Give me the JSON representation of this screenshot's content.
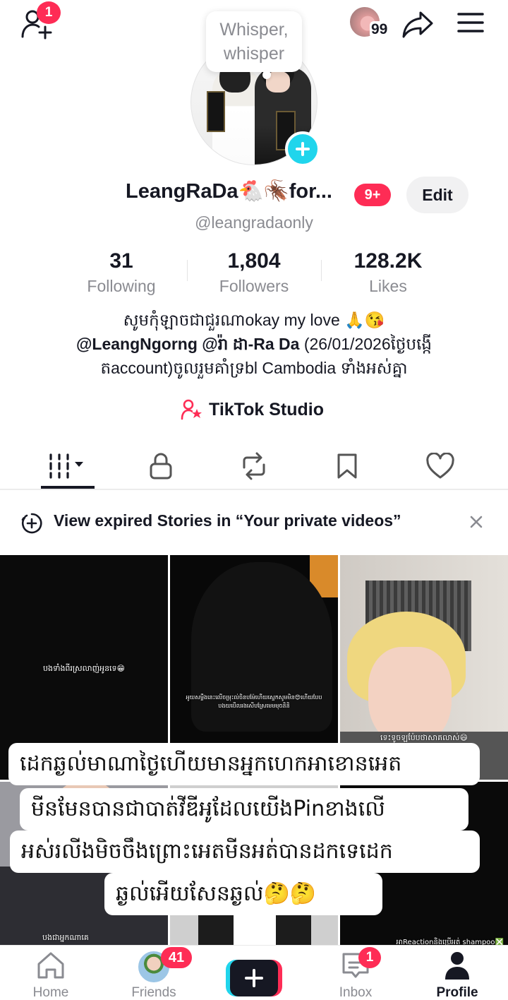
{
  "topbar": {
    "add_friend_badge": "1",
    "visitor_count": "99"
  },
  "profile": {
    "note_bubble": "Whisper, whisper",
    "display_name": "LeangRaDa🐔🪳for...",
    "name_badge": "9+",
    "edit_label": "Edit",
    "username": "@leangradaonly"
  },
  "stats": [
    {
      "value": "31",
      "label": "Following"
    },
    {
      "value": "1,804",
      "label": "Followers"
    },
    {
      "value": "128.2K",
      "label": "Likes"
    }
  ],
  "bio": {
    "line1": "សូមកុំឡាចជាជួរណាokay my love 🙏😘",
    "mentions": "@LeangNgorng @រ៉ា ដា-Ra Da",
    "line2_rest": "  (26/01/2026ថ្ងៃបង្កើ",
    "line3": "តaccount)ចូលរួមគាំទ្រbl Cambodia ទាំងអស់គ្នា"
  },
  "studio_label": "TikTok Studio",
  "tabs": [
    {
      "name": "videos",
      "icon": "grid-columns-icon"
    },
    {
      "name": "private",
      "icon": "lock-icon"
    },
    {
      "name": "reposts",
      "icon": "repost-icon"
    },
    {
      "name": "favorites",
      "icon": "bookmark-icon"
    },
    {
      "name": "liked",
      "icon": "heart-icon"
    }
  ],
  "banner": {
    "text": "View expired Stories in “Your private videos”"
  },
  "videos": [
    {
      "caption": "បងទាំងពីរស្រលាញ់អូនទេ😁"
    },
    {
      "caption": "អូយសម្លឹងនេះលើចម្រុះល់ចិនបម៉ែហើយស្ទេកសូមមិន😍ហើយបែប បងយបើលរងសើបស្រែមេមមុចនិនិ"
    },
    {
      "caption": "ទេះទូចឡប៉ែបថាសាគលាស់😄"
    },
    {
      "caption": "បងជាអ្នកណាគេ"
    },
    {
      "caption": ""
    },
    {
      "caption": "អាReactionនិងប្រើអត់ shampoo❎"
    }
  ],
  "overlay": {
    "lines": [
      "ដេកឆ្ងល់មាណាថ្ងៃហើយមានអ្នកហេកអាខោនអេត",
      "មីនមែនបានជាបាត់វីឌីអូដែលយើងPinខាងលើ",
      "អស់រលីងមិចចឹងព្រោះអេតមីនអត់បានដកទេដេក",
      "ឆ្ងល់អើយសែនឆ្ងល់🤔🤔"
    ]
  },
  "bottom_nav": {
    "home": "Home",
    "friends": "Friends",
    "friends_badge": "41",
    "inbox": "Inbox",
    "inbox_badge": "1",
    "profile": "Profile"
  },
  "colors": {
    "accent_red": "#fe2c55",
    "accent_cyan": "#20d5ec",
    "text_primary": "#161823",
    "text_secondary": "#8a8b91"
  }
}
